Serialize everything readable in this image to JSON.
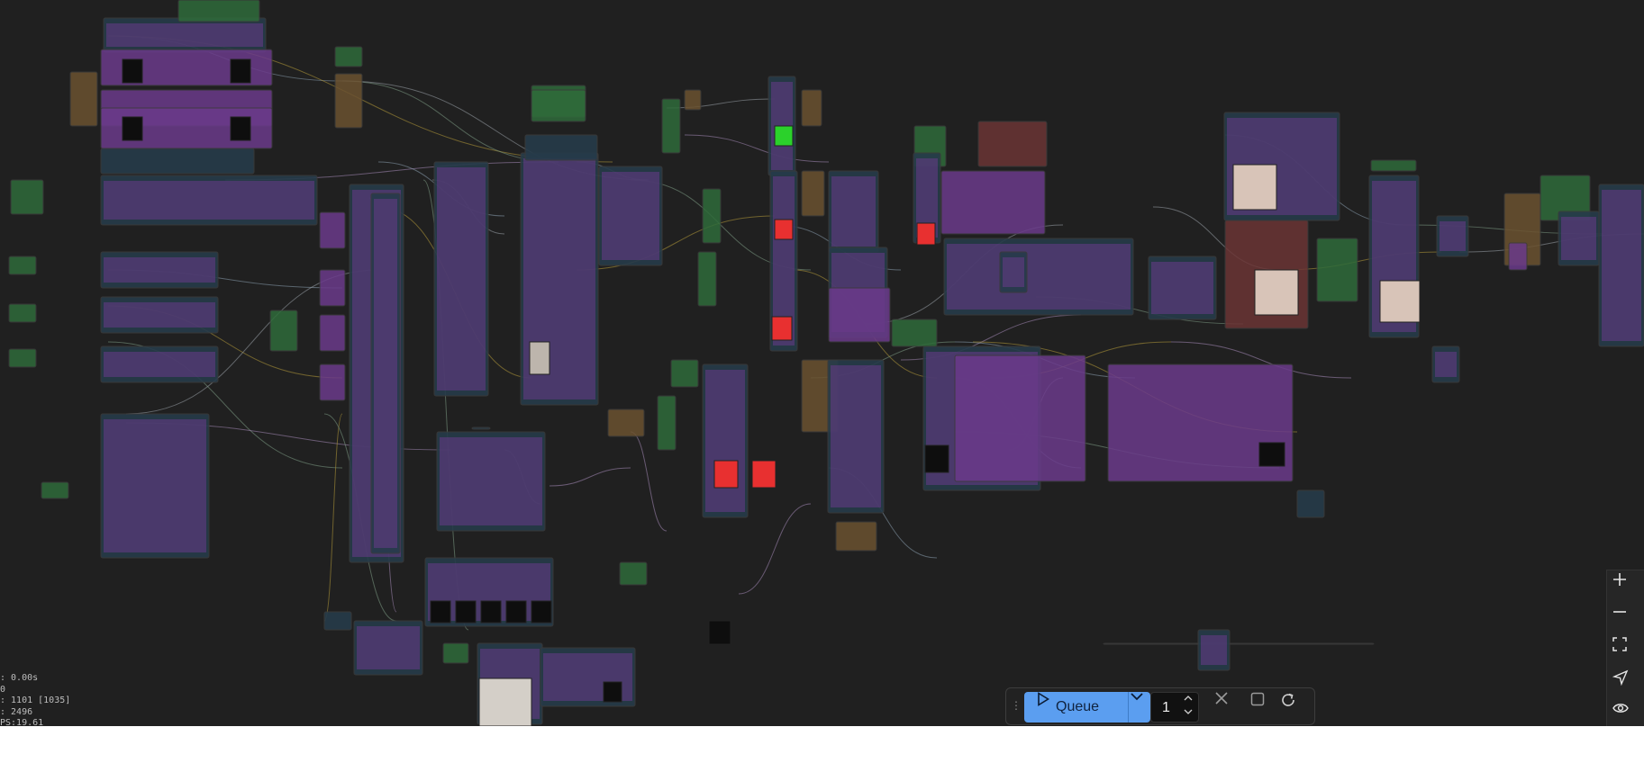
{
  "stats": {
    "line1": ": 0.00s",
    "line2": "0",
    "line3": ": 1101 [1035]",
    "line4": ": 2496",
    "line5": "PS:19.61"
  },
  "queue": {
    "label": "Queue",
    "batch_count": "1"
  },
  "icons": {
    "zoom_in": "plus-icon",
    "zoom_out": "minus-icon",
    "fit_view": "fullscreen-icon",
    "locate": "send-icon",
    "visibility": "eye-icon",
    "queue": "play-icon",
    "dropdown": "chevron-down-icon",
    "cancel": "close-icon",
    "stop": "square-icon",
    "refresh": "refresh-icon"
  },
  "colors": {
    "canvas": "#202020",
    "node_body": "#353535",
    "node_title": "#263b4a",
    "node_purple": "#6a3a8a",
    "node_green": "#2f6b3a",
    "node_brown": "#6b5230",
    "node_red": "#6b3535",
    "queue_accent": "#5b9ef0"
  }
}
